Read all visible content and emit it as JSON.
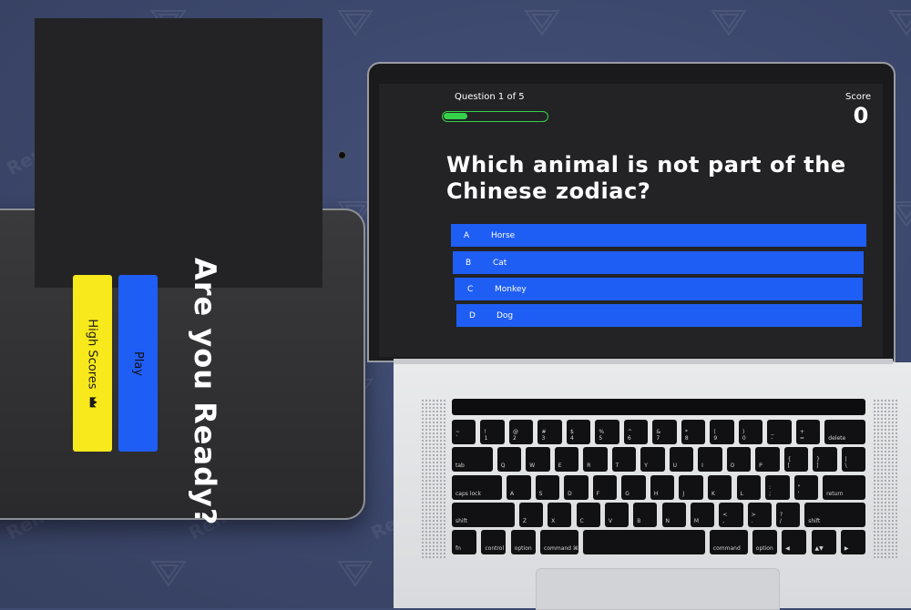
{
  "watermark": "Renderforest",
  "tablet": {
    "title": "Are you Ready?",
    "high_scores_label": "High Scores",
    "high_scores_icon": "crown-icon",
    "play_label": "Play",
    "colors": {
      "high_scores": "#f7e91b",
      "play": "#1f5ef5"
    }
  },
  "quiz": {
    "question_counter": "Question 1 of 5",
    "progress": 0.2,
    "score_label": "Score",
    "score_value": "0",
    "question": "Which animal is not part of the Chinese zodiac?",
    "answers": [
      {
        "letter": "A",
        "text": "Horse"
      },
      {
        "letter": "B",
        "text": "Cat"
      },
      {
        "letter": "C",
        "text": "Monkey"
      },
      {
        "letter": "D",
        "text": "Dog"
      }
    ],
    "colors": {
      "answer": "#1f5ef5",
      "progress": "#35d24a"
    }
  },
  "keyboard": {
    "row1": [
      "~\n`",
      "!\n1",
      "@\n2",
      "#\n3",
      "$\n4",
      "%\n5",
      "^\n6",
      "&\n7",
      "*\n8",
      "(\n9",
      ")\n0",
      "_\n-",
      "+\n=",
      "delete"
    ],
    "row2": [
      "tab",
      "Q",
      "W",
      "E",
      "R",
      "T",
      "Y",
      "U",
      "I",
      "O",
      "P",
      "{\n[",
      "}\n]",
      "|\n\\"
    ],
    "row3": [
      "caps lock",
      "A",
      "S",
      "D",
      "F",
      "G",
      "H",
      "J",
      "K",
      "L",
      ":\n;",
      "\"\n'",
      "return"
    ],
    "row4": [
      "shift",
      "Z",
      "X",
      "C",
      "V",
      "B",
      "N",
      "M",
      "<\n,",
      ">\n.",
      "?\n/",
      "shift"
    ],
    "row5": [
      "fn",
      "control",
      "option",
      "command ⌘",
      "",
      "command",
      "option",
      "◀",
      "▲▼",
      "▶"
    ]
  }
}
